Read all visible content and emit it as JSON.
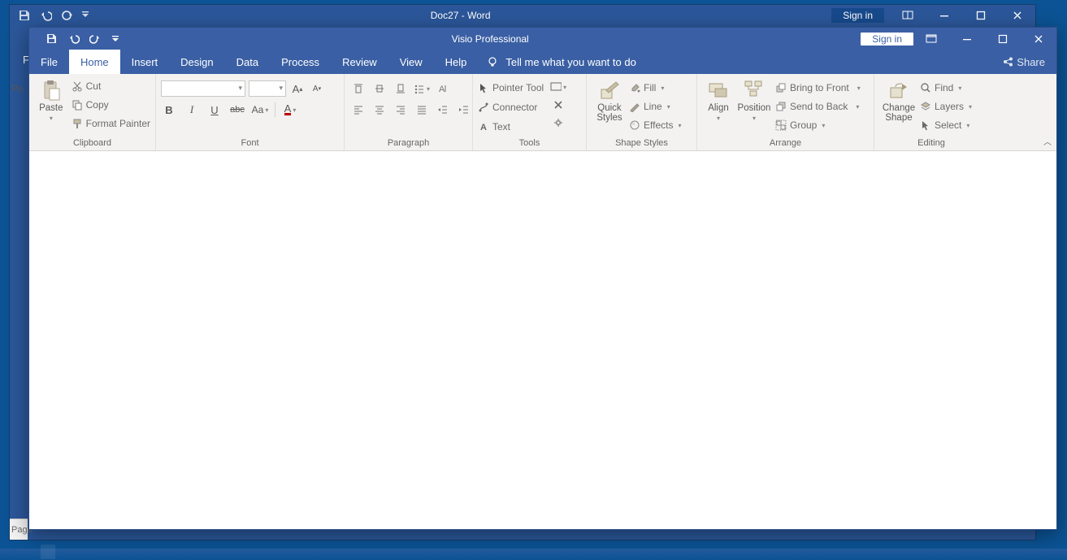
{
  "word": {
    "title": "Doc27  -  Word",
    "sign_in": "Sign in",
    "tab_file_partial": "Fi",
    "partial_left_label": "Pa",
    "status_page_partial": "Page"
  },
  "visio": {
    "title": "Visio Professional",
    "sign_in": "Sign in",
    "tabs": {
      "file": "File",
      "home": "Home",
      "insert": "Insert",
      "design": "Design",
      "data": "Data",
      "process": "Process",
      "review": "Review",
      "view": "View",
      "help": "Help"
    },
    "tell_me": "Tell me what you want to do",
    "share": "Share",
    "ribbon": {
      "clipboard": {
        "label": "Clipboard",
        "paste": "Paste",
        "cut": "Cut",
        "copy": "Copy",
        "format_painter": "Format Painter"
      },
      "font": {
        "label": "Font"
      },
      "paragraph": {
        "label": "Paragraph"
      },
      "tools": {
        "label": "Tools",
        "pointer": "Pointer Tool",
        "connector": "Connector",
        "text": "Text"
      },
      "shape_styles": {
        "label": "Shape Styles",
        "quick_styles": "Quick\nStyles",
        "fill": "Fill",
        "line": "Line",
        "effects": "Effects"
      },
      "arrange": {
        "label": "Arrange",
        "align": "Align",
        "position": "Position",
        "bring_front": "Bring to Front",
        "send_back": "Send to Back",
        "group": "Group"
      },
      "editing": {
        "label": "Editing",
        "change_shape": "Change\nShape",
        "find": "Find",
        "layers": "Layers",
        "select": "Select"
      }
    }
  }
}
